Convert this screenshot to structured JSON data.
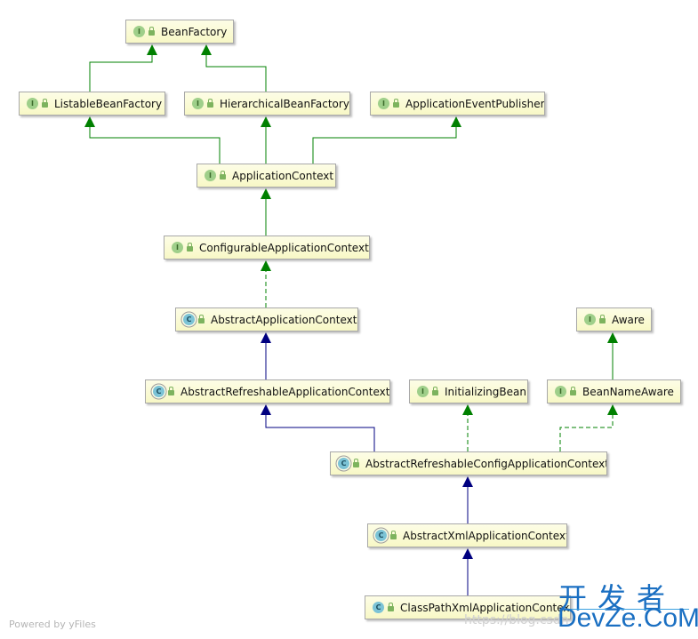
{
  "nodes": [
    {
      "id": "beanfactory",
      "label": "BeanFactory",
      "kind": "I"
    },
    {
      "id": "listable",
      "label": "ListableBeanFactory",
      "kind": "I"
    },
    {
      "id": "hierarchical",
      "label": "HierarchicalBeanFactory",
      "kind": "I"
    },
    {
      "id": "publisher",
      "label": "ApplicationEventPublisher",
      "kind": "I"
    },
    {
      "id": "appctx",
      "label": "ApplicationContext",
      "kind": "I"
    },
    {
      "id": "configurable",
      "label": "ConfigurableApplicationContext",
      "kind": "I"
    },
    {
      "id": "abstractctx",
      "label": "AbstractApplicationContext",
      "kind": "A"
    },
    {
      "id": "aware",
      "label": "Aware",
      "kind": "I"
    },
    {
      "id": "refreshable",
      "label": "AbstractRefreshableApplicationContext",
      "kind": "A"
    },
    {
      "id": "initializing",
      "label": "InitializingBean",
      "kind": "I"
    },
    {
      "id": "beannameaware",
      "label": "BeanNameAware",
      "kind": "I"
    },
    {
      "id": "refreshableconfig",
      "label": "AbstractRefreshableConfigApplicationContext",
      "kind": "A"
    },
    {
      "id": "abstractxml",
      "label": "AbstractXmlApplicationContext",
      "kind": "A"
    },
    {
      "id": "classpathxml",
      "label": "ClassPathXmlApplicationContext",
      "kind": "C"
    }
  ],
  "edges": [
    {
      "from": "listable",
      "to": "beanfactory",
      "type": "extends-interface"
    },
    {
      "from": "hierarchical",
      "to": "beanfactory",
      "type": "extends-interface"
    },
    {
      "from": "appctx",
      "to": "listable",
      "type": "extends-interface"
    },
    {
      "from": "appctx",
      "to": "hierarchical",
      "type": "extends-interface"
    },
    {
      "from": "appctx",
      "to": "publisher",
      "type": "extends-interface"
    },
    {
      "from": "configurable",
      "to": "appctx",
      "type": "extends-interface"
    },
    {
      "from": "abstractctx",
      "to": "configurable",
      "type": "implements"
    },
    {
      "from": "refreshable",
      "to": "abstractctx",
      "type": "extends-class"
    },
    {
      "from": "beannameaware",
      "to": "aware",
      "type": "extends-interface"
    },
    {
      "from": "refreshableconfig",
      "to": "refreshable",
      "type": "extends-class"
    },
    {
      "from": "refreshableconfig",
      "to": "initializing",
      "type": "implements"
    },
    {
      "from": "refreshableconfig",
      "to": "beannameaware",
      "type": "implements"
    },
    {
      "from": "abstractxml",
      "to": "refreshableconfig",
      "type": "extends-class"
    },
    {
      "from": "classpathxml",
      "to": "abstractxml",
      "type": "extends-class"
    }
  ],
  "colors": {
    "interface_edge": "#008000",
    "class_edge": "#000080"
  },
  "footer": "Powered by yFiles",
  "watermark": {
    "url": "https://blog.csdn",
    "cn": "开发者",
    "en": "DevZe.CoM"
  }
}
